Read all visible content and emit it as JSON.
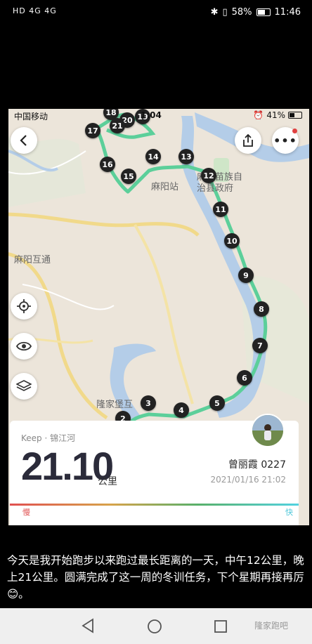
{
  "outer_status": {
    "network": "HD 4G 4G",
    "battery": "58%",
    "time": "11:46"
  },
  "inner_status": {
    "carrier": "中国移动",
    "time": "1:04",
    "battery": "41%"
  },
  "map": {
    "labels": {
      "mayang_station": "麻阳站",
      "mayang_interchange": "麻阳互通",
      "longjiabao": "隆家堡互",
      "county_gov_line1": "麻阳苗族自",
      "county_gov_line2": "治县政府"
    },
    "km_markers": [
      "2",
      "3",
      "4",
      "5",
      "6",
      "7",
      "8",
      "9",
      "10",
      "11",
      "12",
      "13",
      "14",
      "15",
      "16",
      "17",
      "18",
      "19",
      "20",
      "21"
    ],
    "route_color": "#5ccf9a",
    "river_color": "#b4cde8"
  },
  "card": {
    "app": "Keep · 锦江河",
    "distance": "21.10",
    "unit": "公里",
    "user": "曾丽霞 0227",
    "datetime": "2021/01/16 21:02",
    "slow": "慢",
    "fast": "快"
  },
  "caption": "今天是我开始跑步以来跑过最长距离的一天，中午12公里，晚上21公里。圆满完成了这一周的冬训任务，下个星期再接再厉😊。",
  "watermark": "隆家跑吧"
}
